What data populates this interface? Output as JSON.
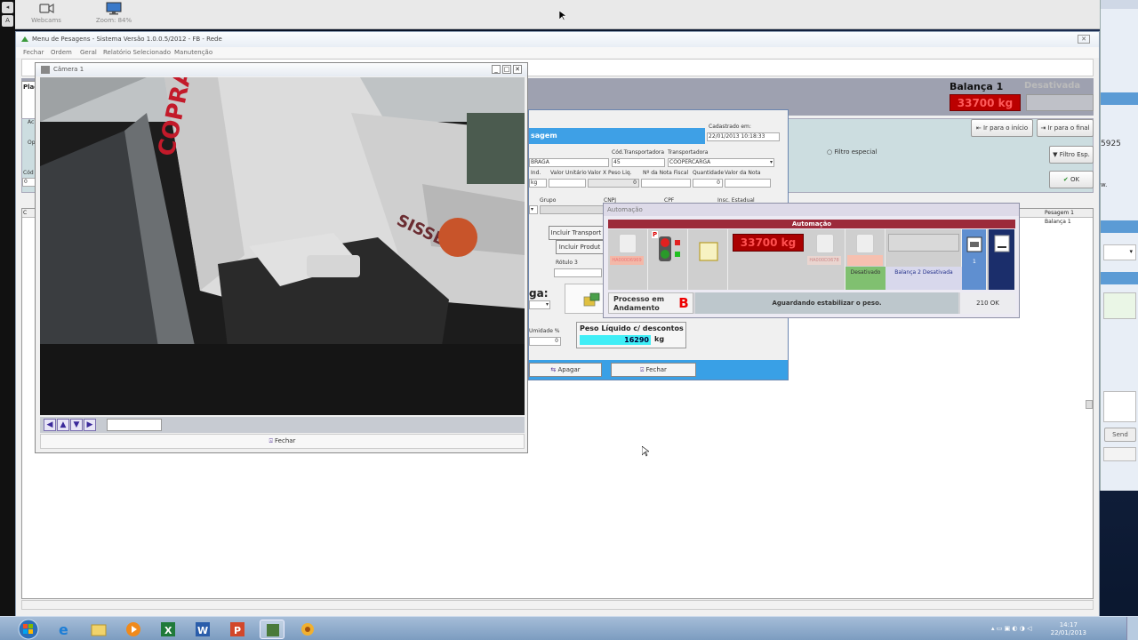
{
  "host": {
    "webcams_label": "Webcams",
    "zoom_label": "Zoom: 84%"
  },
  "main_window": {
    "title": "Menu de Pesagens - Sistema Versão 1.0.0.5/2012 - FB - Rede",
    "menu": [
      "Fechar",
      "Ordem",
      "Geral",
      "Relatório Selecionado",
      "Manutenção"
    ],
    "balanca_label": "Balança 1",
    "desativada_label": "Desativada",
    "balanca_weight": "33700 kg",
    "btn_inicio": "Ir para o início",
    "btn_final": "Ir para o final",
    "filtro_especial": "Filtro especial",
    "btn_filtro": "Filtro Esp.",
    "btn_ok": "OK",
    "grid_col_pesagem": "Pesagem 1",
    "grid_cell_balanca": "Balança 1",
    "left_labels": [
      "Plac",
      "Ac",
      "Op",
      "Cód",
      "0",
      "C"
    ]
  },
  "camera": {
    "title": "Câmera 1",
    "truck_text_1": "COPRAGA",
    "truck_text_2": "SISSEYS",
    "fechar": "Fechar"
  },
  "pesagem": {
    "band": "sagem",
    "cadastrado_label": "Cadastrado em:",
    "cadastrado_value": "22/01/2013 10:18:33",
    "cod_transp_label": "Cód.Transportadora",
    "transp_label": "Transportadora",
    "empresa_value": "BRAGA",
    "cod_transp_value": "45",
    "transp_value": "COOPERCARGA",
    "headers_row": [
      "Ind.",
      "Valor Unitário",
      "Valor X Peso Liq.",
      "Nº da Nota Fiscal",
      "Quantidade",
      "Valor da Nota"
    ],
    "left_small": "kg",
    "valor_peso_value": "0",
    "quantidade_value": "0",
    "grupo_label": "Grupo",
    "cnpj_label": "CNPJ",
    "cpf_label": "CPF",
    "insc_label": "Insc. Estadual",
    "incluir_transp": "Incluir Transport",
    "incluir_produt": "Incluir Produt",
    "rotulo3": "Rótulo 3",
    "carga_label": "ga:",
    "umidade_label": "Umidade %",
    "umidade_value": "0",
    "peso_liquido_label": "Peso Líquido c/ descontos",
    "peso_liquido_value": "16290",
    "peso_unit": "kg",
    "btn_apagar": "Apagar",
    "btn_fechar": "Fechar"
  },
  "automacao": {
    "title": "Automação",
    "header": "Automação",
    "sensor1": "HA000D6969",
    "sensor2": "HA000D3678",
    "p_label": "P",
    "weight": "33700 kg",
    "desativado": "Desativado",
    "balanca2": "Balança 2 Desativada",
    "counter": "1",
    "processo_line1": "Processo em",
    "processo_line2": "Andamento",
    "badge": "B",
    "status": "Aguardando estabilizar o peso.",
    "ok_count": "210 OK"
  },
  "right_window": {
    "number": "5925",
    "text_w": "w.",
    "send": "Send"
  },
  "taskbar": {
    "time": "14:17",
    "date": "22/01/2013"
  }
}
